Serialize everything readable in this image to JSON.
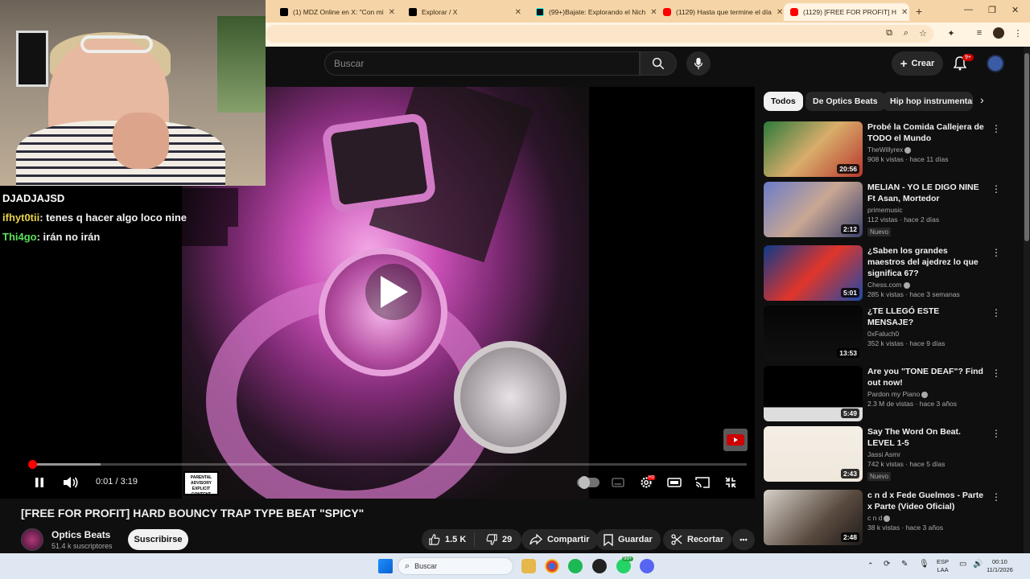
{
  "browser": {
    "tabs": [
      {
        "label": "(1) MDZ Online en X: \"Con mi",
        "icon": "x-logo-icon",
        "active": false
      },
      {
        "label": "Explorar / X",
        "icon": "x-logo-icon",
        "active": false
      },
      {
        "label": "(99+)Bajate: Explorando el Nich",
        "icon": "tiktok-icon",
        "active": false
      },
      {
        "label": "(1129) Hasta que termine el día",
        "icon": "youtube-icon",
        "active": false
      },
      {
        "label": "(1129) [FREE FOR PROFIT] H",
        "icon": "youtube-icon",
        "active": true
      }
    ],
    "new_tab": "+",
    "window_controls": {
      "minimize": "—",
      "maximize": "❐",
      "close": "✕"
    }
  },
  "youtube_header": {
    "search_placeholder": "Buscar",
    "create_label": "Crear",
    "notification_count": "9+"
  },
  "player": {
    "current_time": "0:01",
    "duration": "3:19",
    "time_separator": "/",
    "progress_fraction": 0.0003,
    "buffered_fraction": 0.1,
    "advisory_text": "PARENTAL ADVISORY EXPLICIT CONTENT"
  },
  "stream_chat": [
    {
      "user": "DJADJAJSD",
      "message": "",
      "color": "#ffffff"
    },
    {
      "user": "ifhyt0tii",
      "message": ": tenes q hacer algo loco nine",
      "color": "#e8d24a"
    },
    {
      "user": "Thi4go",
      "message": ": irán no irán",
      "color": "#5be05b"
    }
  ],
  "video": {
    "title": "[FREE FOR PROFIT] HARD BOUNCY TRAP TYPE BEAT \"SPICY\"",
    "channel": "Optics Beats",
    "subscribers": "51.4 k suscriptores",
    "subscribe_label": "Suscribirse",
    "likes": "1.5 K",
    "dislikes": "29",
    "share_label": "Compartir",
    "save_label": "Guardar",
    "clip_label": "Recortar",
    "more_label": "•••"
  },
  "sidebar": {
    "chips": [
      "Todos",
      "De Optics Beats",
      "Hip hop instrumental"
    ],
    "recommendations": [
      {
        "title": "Probé la Comida Callejera de TODO el Mundo",
        "channel": "TheWillyrex",
        "verified": true,
        "stats": "908 k vistas · hace 11 días",
        "duration": "20:56",
        "badge": "",
        "thumb": "linear-gradient(135deg,#2c7a3a,#d9ad6b 50%,#b7372c)"
      },
      {
        "title": "MELIAN - YO LE DIGO NINE Ft Asan, Mortedor",
        "channel": "primemusic",
        "verified": false,
        "stats": "112 vistas · hace 2 días",
        "duration": "2:12",
        "badge": "Nuevo",
        "thumb": "linear-gradient(135deg,#6a7cc9,#c9a793 50%,#3a3f6a)"
      },
      {
        "title": "¿Saben los grandes maestros del ajedrez lo que significa 67?",
        "channel": "Chess.com",
        "verified": true,
        "stats": "285 k vistas · hace 3 semanas",
        "duration": "5:01",
        "badge": "",
        "thumb": "linear-gradient(135deg,#0d3a8a,#e0352b 50%,#1c4aa8)"
      },
      {
        "title": "¿TE LLEGÓ ESTE MENSAJE?",
        "channel": "0xFaluch0",
        "verified": false,
        "stats": "352 k vistas · hace 9 días",
        "duration": "13:53",
        "badge": "",
        "thumb": "linear-gradient(180deg,#050505,#111)"
      },
      {
        "title": "Are you \"TONE DEAF\"? Find out now!",
        "channel": "Pardon my Piano",
        "verified": true,
        "stats": "2.3 M de vistas · hace 3 años",
        "duration": "5:49",
        "badge": "",
        "thumb": "linear-gradient(180deg,#000 0%,#000 75%,#ddd 75%)"
      },
      {
        "title": "Say The Word On Beat. LEVEL 1-5",
        "channel": "Jassi Asmr",
        "verified": false,
        "stats": "742 k vistas · hace 5 días",
        "duration": "2:43",
        "badge": "Nuevo",
        "thumb": "linear-gradient(180deg,#f4eee6,#efe7db)"
      },
      {
        "title": "c n d x Fede Guelmos - Parte x Parte (Video Oficial)",
        "channel": "c n d",
        "verified": true,
        "stats": "38 k vistas · hace 3 años",
        "duration": "2:48",
        "badge": "",
        "thumb": "linear-gradient(135deg,#d6d1c9,#5a4b40 60%,#1e1a18)"
      }
    ]
  },
  "taskbar": {
    "search_label": "Buscar",
    "lang": "ESP",
    "lang2": "LAA",
    "time": "00:10",
    "date": "11/1/2026",
    "whatsapp_badge": "99+"
  },
  "colors": {
    "accent_red": "#ff0000",
    "bg": "#0f0f0f",
    "tab_bar": "#f5d5a8"
  }
}
